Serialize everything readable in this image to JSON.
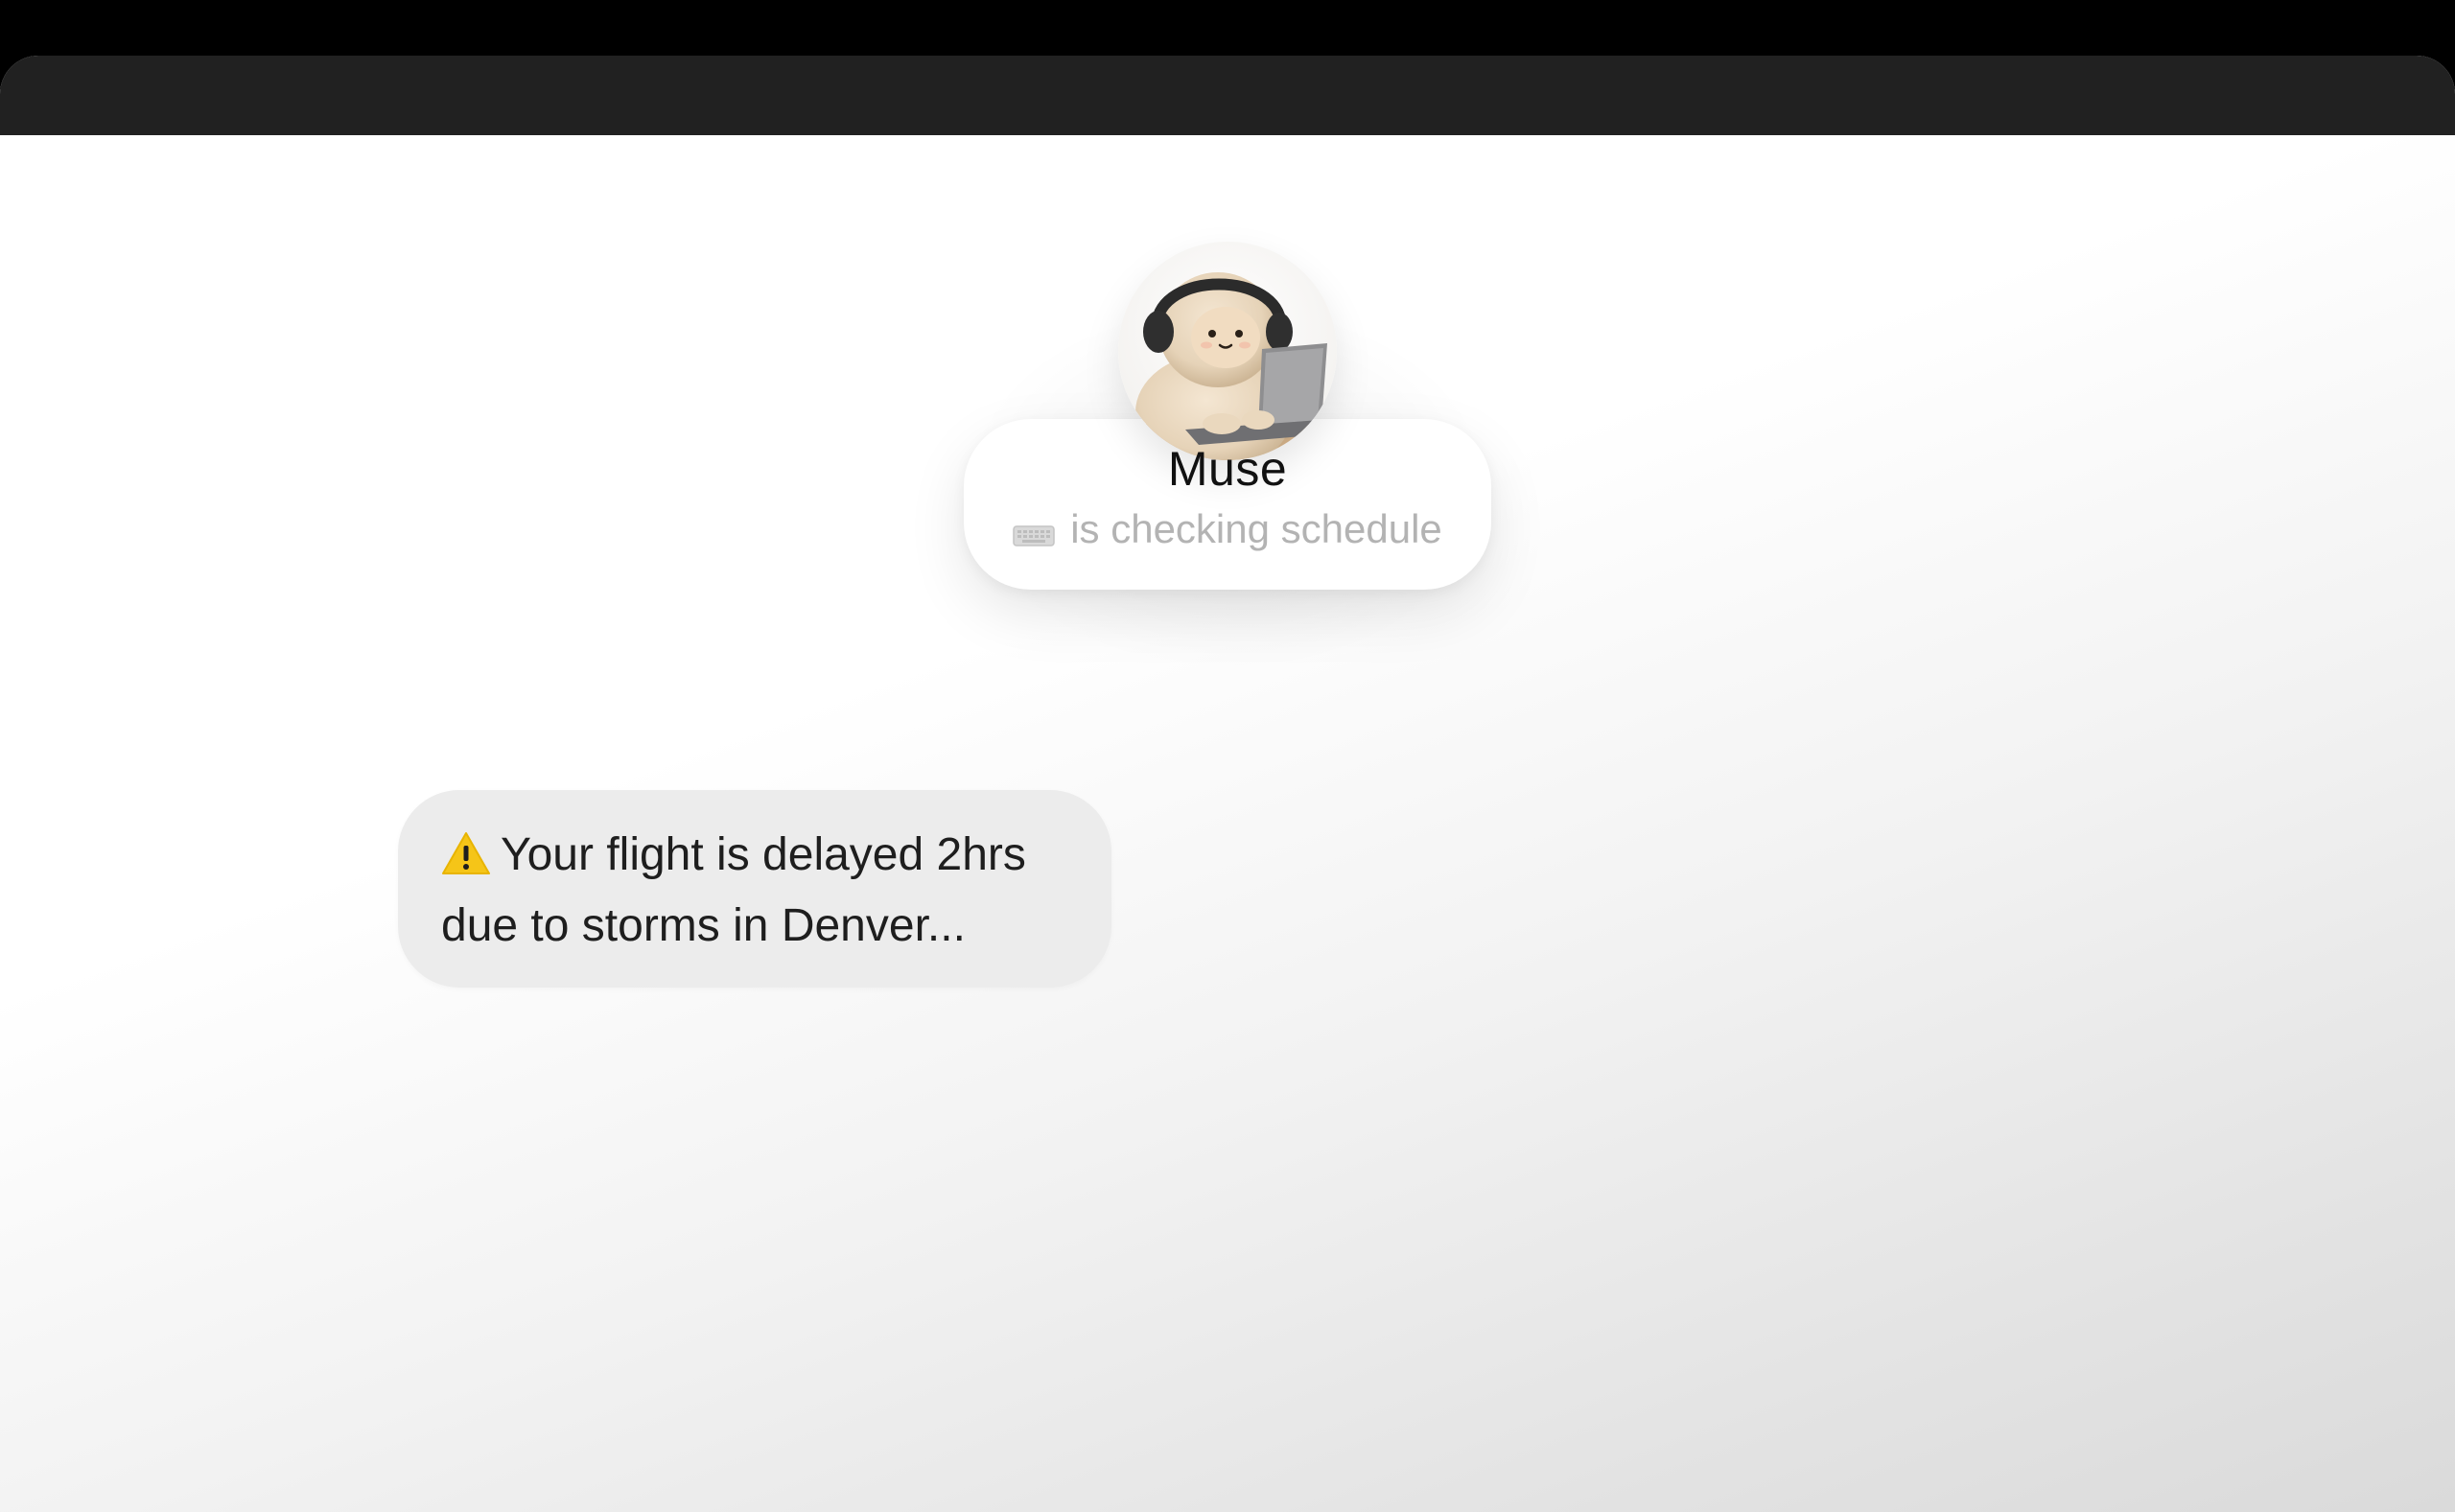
{
  "agent": {
    "name": "Muse",
    "status_text": "is checking schedule",
    "status_icon": "keyboard-icon",
    "avatar": "plush-character-with-headphones-and-laptop"
  },
  "message": {
    "icon": "warning-icon",
    "text": "Your flight is delayed 2hrs due to storms in Denver..."
  },
  "colors": {
    "titlebar": "#212121",
    "bubble": "#ececec",
    "status_text": "#b3b3b3",
    "warning": "#f5c518"
  }
}
